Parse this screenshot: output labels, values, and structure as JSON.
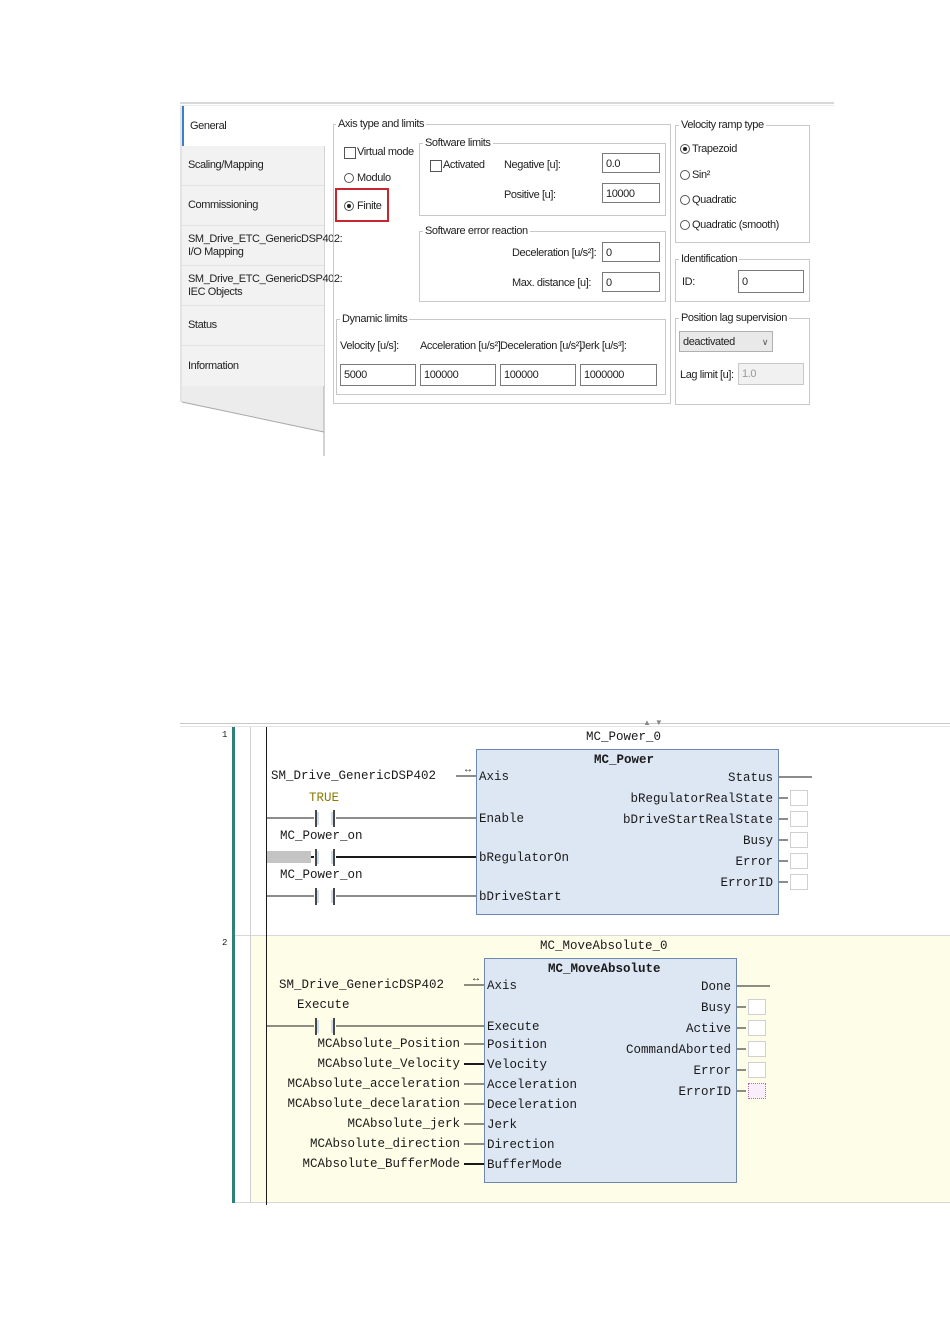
{
  "config": {
    "tabs": [
      {
        "label": "General",
        "active": true
      },
      {
        "label": "Scaling/Mapping"
      },
      {
        "label": "Commissioning"
      },
      {
        "label": "SM_Drive_ETC_GenericDSP402: I/O Mapping"
      },
      {
        "label": "SM_Drive_ETC_GenericDSP402: IEC Objects"
      },
      {
        "label": "Status"
      },
      {
        "label": "Information"
      }
    ],
    "axis_type": {
      "legend": "Axis type and limits",
      "virtual_mode": "Virtual mode",
      "modulo": "Modulo",
      "finite": "Finite"
    },
    "software_limits": {
      "legend": "Software limits",
      "activated": "Activated",
      "negative_label": "Negative [u]:",
      "negative_value": "0.0",
      "positive_label": "Positive [u]:",
      "positive_value": "10000"
    },
    "software_error_reaction": {
      "legend": "Software error reaction",
      "deceleration_label": "Deceleration [u/s²]:",
      "deceleration_value": "0",
      "max_distance_label": "Max. distance [u]:",
      "max_distance_value": "0"
    },
    "dynamic_limits": {
      "legend": "Dynamic limits",
      "velocity_label": "Velocity [u/s]:",
      "velocity_value": "5000",
      "acceleration_label": "Acceleration [u/s²]",
      "acceleration_value": "100000",
      "deceleration_label": "Deceleration [u/s²]",
      "deceleration_value": "100000",
      "jerk_label": "Jerk [u/s³]:",
      "jerk_value": "1000000"
    },
    "velocity_ramp": {
      "legend": "Velocity ramp type",
      "trapezoid": "Trapezoid",
      "sin2": "Sin²",
      "quadratic": "Quadratic",
      "quadratic_smooth": "Quadratic (smooth)"
    },
    "identification": {
      "legend": "Identification",
      "id_label": "ID:",
      "id_value": "0"
    },
    "position_lag": {
      "legend": "Position lag supervision",
      "mode": "deactivated",
      "lag_limit_label": "Lag limit [u]:",
      "lag_limit_value": "1.0"
    },
    "colors": {
      "highlight": "#c8262f",
      "tab_accent": "#3c7fc4"
    }
  },
  "ladder": {
    "network1": {
      "number": "1",
      "instance": "MC_Power_0",
      "type": "MC_Power",
      "axis_var": "SM_Drive_GenericDSP402",
      "const_true": "TRUE",
      "contact1_var": "MC_Power_on",
      "contact2_var": "MC_Power_on",
      "inputs": [
        "Axis",
        "Enable",
        "bRegulatorOn",
        "bDriveStart"
      ],
      "outputs": [
        "Status",
        "bRegulatorRealState",
        "bDriveStartRealState",
        "Busy",
        "Error",
        "ErrorID"
      ]
    },
    "network2": {
      "number": "2",
      "instance": "MC_MoveAbsolute_0",
      "type": "MC_MoveAbsolute",
      "axis_var": "SM_Drive_GenericDSP402",
      "contact_var": "Execute",
      "input_vars": [
        "MCAbsolute_Position",
        "MCAbsolute_Velocity",
        "MCAbsolute_acceleration",
        "MCAbsolute_decelaration",
        "MCAbsolute_jerk",
        "MCAbsolute_direction",
        "MCAbsolute_BufferMode"
      ],
      "inputs": [
        "Axis",
        "Execute",
        "Position",
        "Velocity",
        "Acceleration",
        "Deceleration",
        "Jerk",
        "Direction",
        "BufferMode"
      ],
      "outputs": [
        "Done",
        "Busy",
        "Active",
        "CommandAborted",
        "Error",
        "ErrorID"
      ]
    },
    "colors": {
      "block_fill": "#dde6f3",
      "network2_bg": "#fdfde8",
      "rail": "#2f7f7a",
      "true_text": "#8a7a00"
    }
  }
}
